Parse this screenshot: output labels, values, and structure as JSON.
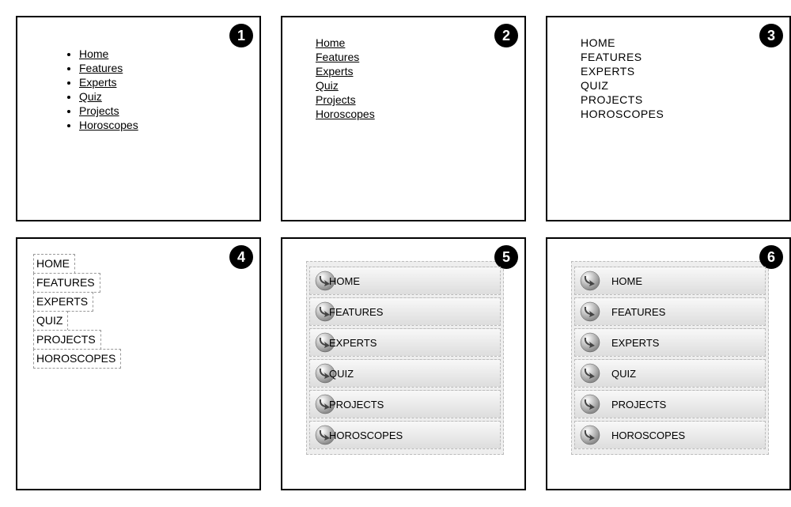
{
  "nav_items": [
    "Home",
    "Features",
    "Experts",
    "Quiz",
    "Projects",
    "Horoscopes"
  ],
  "panels": [
    {
      "num": "1"
    },
    {
      "num": "2"
    },
    {
      "num": "3"
    },
    {
      "num": "4"
    },
    {
      "num": "5"
    },
    {
      "num": "6"
    }
  ]
}
